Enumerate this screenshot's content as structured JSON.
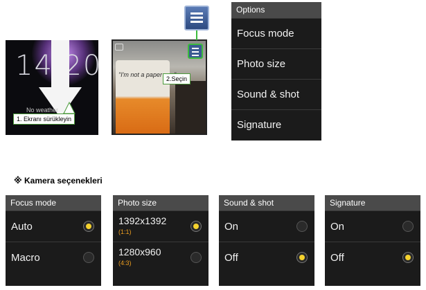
{
  "lockscreen": {
    "clock": "14:20",
    "weather": "No weather",
    "callout": "1. Ekranı sürükleyin"
  },
  "camera": {
    "cup_text": "\"I'm not a paper cup\"",
    "callout": "2.Seçin"
  },
  "options": {
    "header": "Options",
    "items": [
      {
        "label": "Focus mode"
      },
      {
        "label": "Photo size"
      },
      {
        "label": "Sound & shot"
      },
      {
        "label": "Signature"
      }
    ]
  },
  "section_title": "※ Kamera seçenekleri",
  "focus_mode": {
    "header": "Focus mode",
    "items": [
      {
        "label": "Auto",
        "selected": true
      },
      {
        "label": "Macro",
        "selected": false
      }
    ]
  },
  "photo_size": {
    "header": "Photo size",
    "items": [
      {
        "label": "1392x1392",
        "ratio": "(1:1)",
        "selected": true
      },
      {
        "label": "1280x960",
        "ratio": "(4:3)",
        "selected": false
      }
    ]
  },
  "sound_shot": {
    "header": "Sound & shot",
    "items": [
      {
        "label": "On",
        "selected": false
      },
      {
        "label": "Off",
        "selected": true
      }
    ]
  },
  "signature": {
    "header": "Signature",
    "items": [
      {
        "label": "On",
        "selected": false
      },
      {
        "label": "Off",
        "selected": true
      }
    ]
  },
  "colors": {
    "accent_green": "#3cbb3c",
    "radio_selected": "#f5d22e",
    "ratio_text": "#f0a020"
  }
}
